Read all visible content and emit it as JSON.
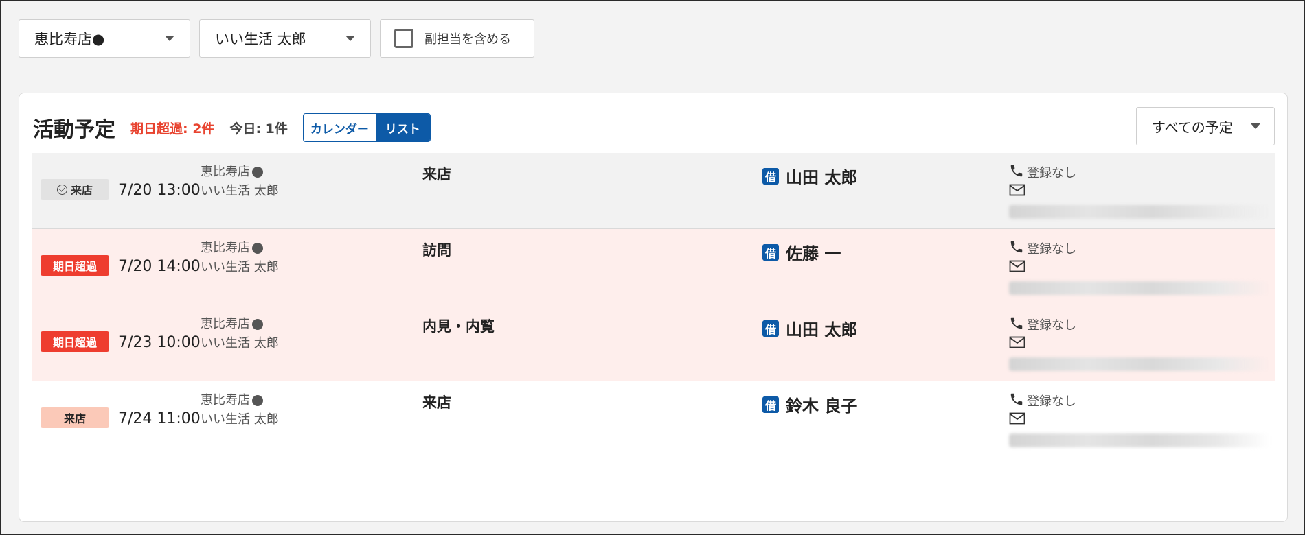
{
  "filters": {
    "shop": "恵比寿店●",
    "staff": "いい生活 太郎",
    "include_sub": "副担当を含める"
  },
  "panel": {
    "title": "活動予定",
    "overdue": "期日超過: 2件",
    "today": "今日: 1件",
    "view_toggle": {
      "calendar": "カレンダー",
      "list": "リスト",
      "active": "リスト"
    },
    "filter_select": "すべての予定"
  },
  "rows": [
    {
      "status": "done",
      "badge": "来店",
      "datetime": "7/20 13:00",
      "shop": "恵比寿店",
      "staff": "いい生活 太郎",
      "activity": "来店",
      "tag": "借",
      "customer": "山田 太郎",
      "phone": "登録なし"
    },
    {
      "status": "late",
      "badge": "期日超過",
      "datetime": "7/20 14:00",
      "shop": "恵比寿店",
      "staff": "いい生活 太郎",
      "activity": "訪問",
      "tag": "借",
      "customer": "佐藤 一",
      "phone": "登録なし"
    },
    {
      "status": "late",
      "badge": "期日超過",
      "datetime": "7/23 10:00",
      "shop": "恵比寿店",
      "staff": "いい生活 太郎",
      "activity": "内見・内覧",
      "tag": "借",
      "customer": "山田 太郎",
      "phone": "登録なし"
    },
    {
      "status": "visit",
      "badge": "来店",
      "datetime": "7/24 11:00",
      "shop": "恵比寿店",
      "staff": "いい生活 太郎",
      "activity": "来店",
      "tag": "借",
      "customer": "鈴木 良子",
      "phone": "登録なし"
    }
  ],
  "colors": {
    "accent": "#0d5aa7",
    "overdue": "#ee3d2f",
    "visit_badge": "#fbc9b8",
    "late_row": "#feeeec"
  }
}
